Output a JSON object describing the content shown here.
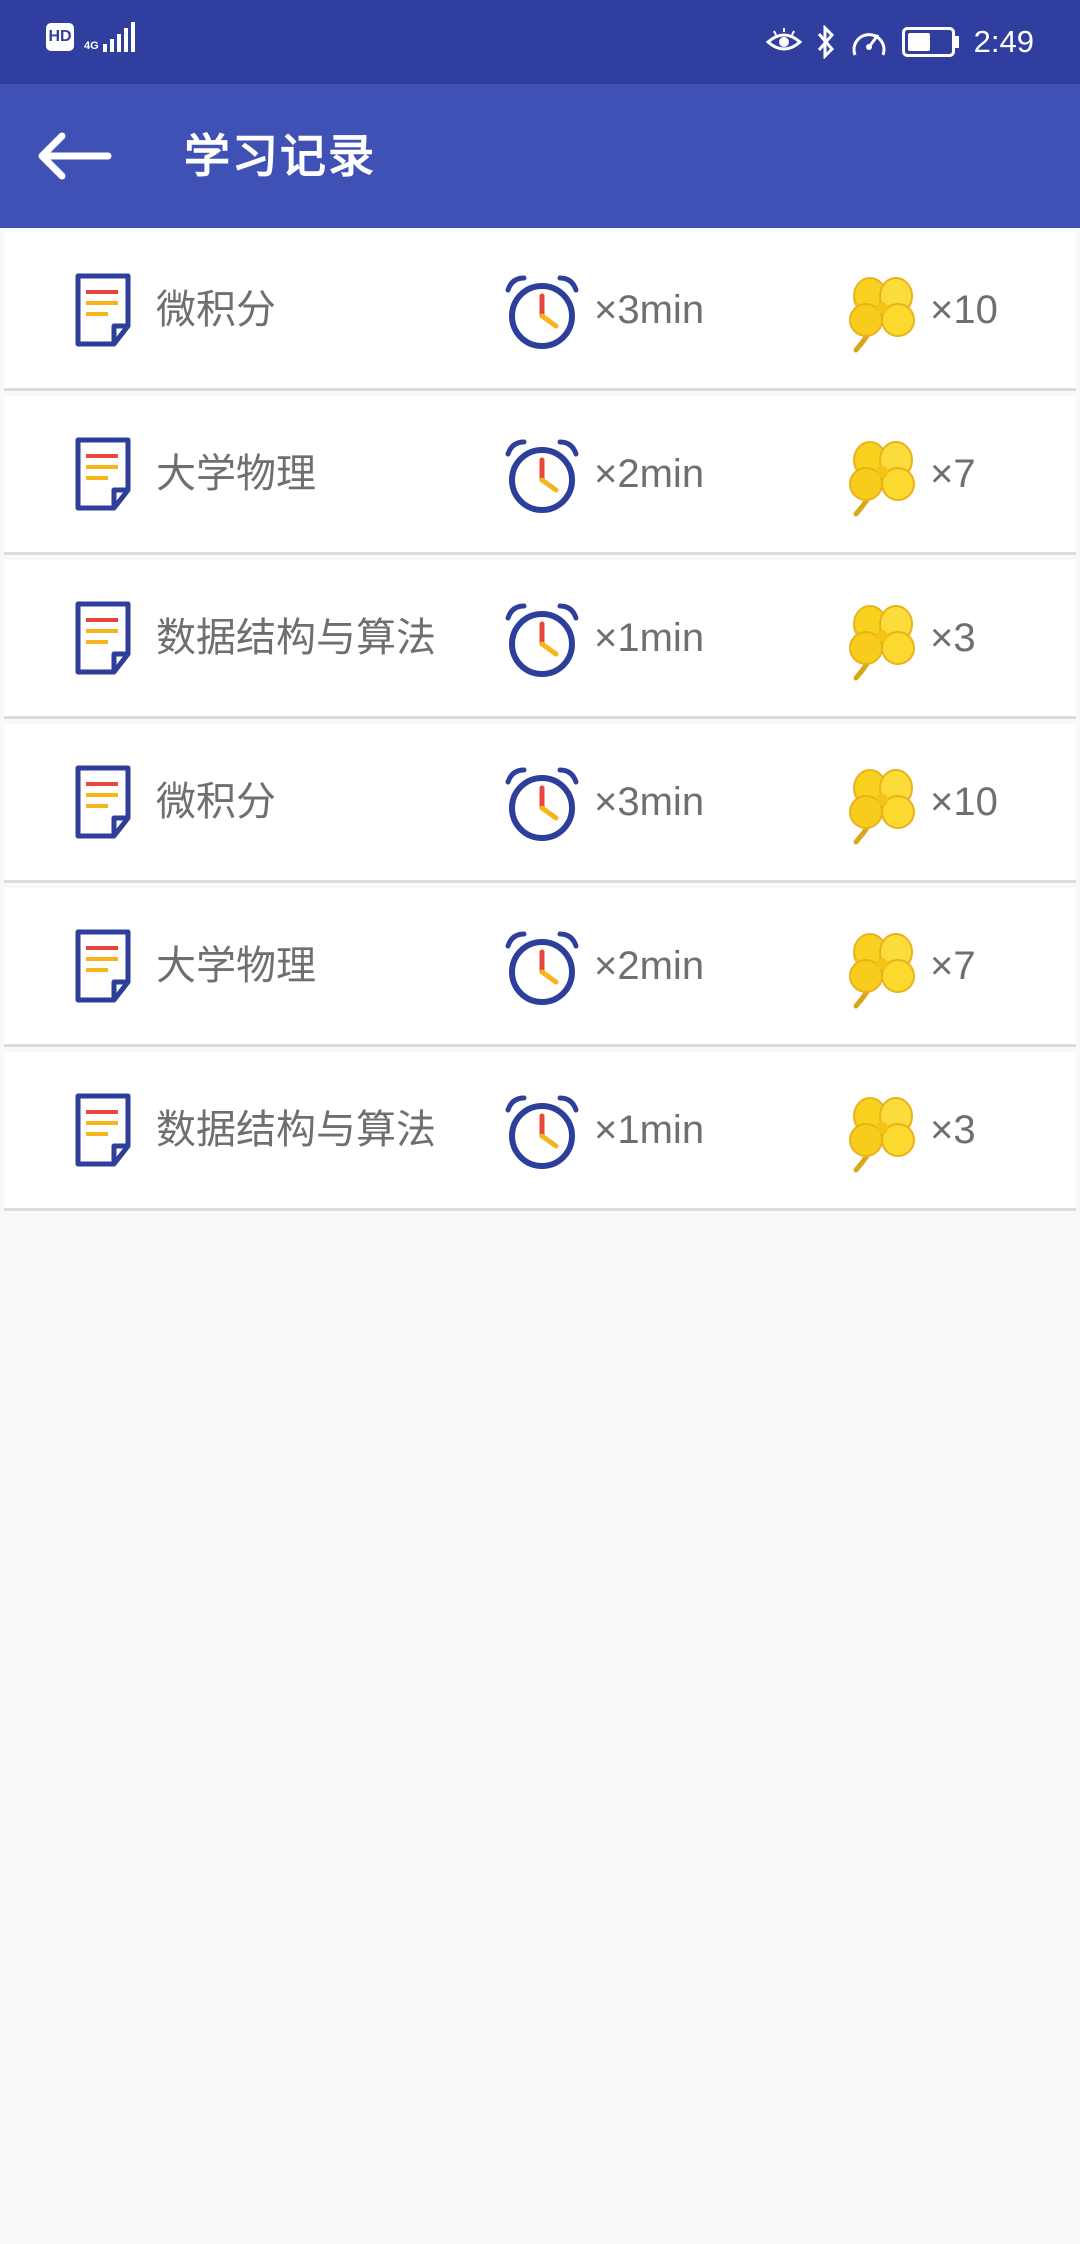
{
  "status_bar": {
    "hd_label": "HD",
    "network_label": "4G",
    "time": "2:49"
  },
  "app_bar": {
    "title": "学习记录"
  },
  "records": [
    {
      "subject": "微积分",
      "duration": "×3min",
      "points": "×10"
    },
    {
      "subject": "大学物理",
      "duration": "×2min",
      "points": "×7"
    },
    {
      "subject": "数据结构与算法",
      "duration": "×1min",
      "points": "×3"
    },
    {
      "subject": "微积分",
      "duration": "×3min",
      "points": "×10"
    },
    {
      "subject": "大学物理",
      "duration": "×2min",
      "points": "×7"
    },
    {
      "subject": "数据结构与算法",
      "duration": "×1min",
      "points": "×3"
    }
  ],
  "colors": {
    "status_bar": "#303f9f",
    "app_bar": "#3f51b5",
    "icon_blue": "#2d3f9a",
    "icon_accent_red": "#e8453c",
    "icon_accent_yellow": "#f5b51b",
    "clover_yellow": "#f9d21f"
  },
  "icons": {
    "back": "arrow-left-icon",
    "record": "document-icon",
    "time": "alarm-clock-icon",
    "reward": "four-leaf-clover-icon"
  }
}
